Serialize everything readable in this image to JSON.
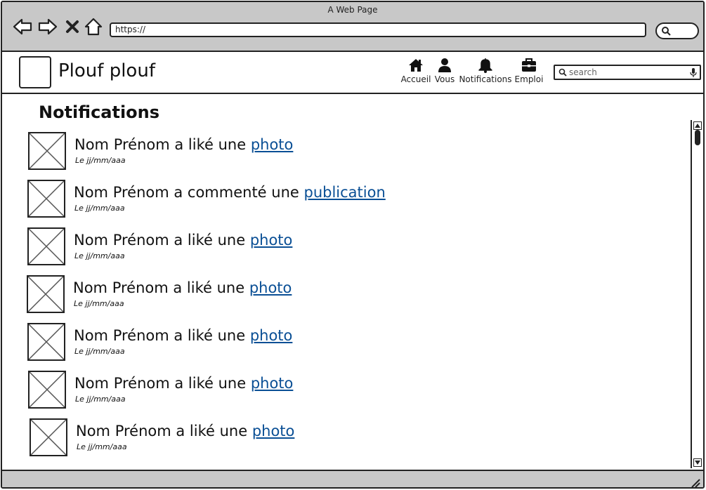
{
  "window": {
    "title": "A Web Page"
  },
  "browser": {
    "url": "https://"
  },
  "header": {
    "brand": "Plouf plouf",
    "nav": [
      {
        "label": "Accueil",
        "icon": "home-icon"
      },
      {
        "label": "Vous",
        "icon": "user-icon"
      },
      {
        "label": "Notifications",
        "icon": "bell-icon"
      },
      {
        "label": "Emploi",
        "icon": "briefcase-icon"
      }
    ],
    "search_placeholder": "search"
  },
  "main": {
    "title": "Notifications",
    "notifications": [
      {
        "text": "Nom Prénom a liké une ",
        "link": "photo",
        "date": "Le jj/mm/aaa"
      },
      {
        "text": "Nom Prénom a commenté une ",
        "link": "publication",
        "date": "Le jj/mm/aaa"
      },
      {
        "text": "Nom Prénom a liké une ",
        "link": "photo",
        "date": "Le jj/mm/aaa"
      },
      {
        "text": "Nom Prénom a liké une ",
        "link": "photo",
        "date": "Le jj/mm/aaa"
      },
      {
        "text": "Nom Prénom a liké une ",
        "link": "photo",
        "date": "Le jj/mm/aaa"
      },
      {
        "text": "Nom Prénom a liké une ",
        "link": "photo",
        "date": "Le jj/mm/aaa"
      },
      {
        "text": "Nom Prénom a liké une ",
        "link": "photo",
        "date": "Le jj/mm/aaa"
      }
    ]
  },
  "colors": {
    "chrome": "#c8c8c8",
    "link": "#0a4f95",
    "border": "#222222"
  }
}
